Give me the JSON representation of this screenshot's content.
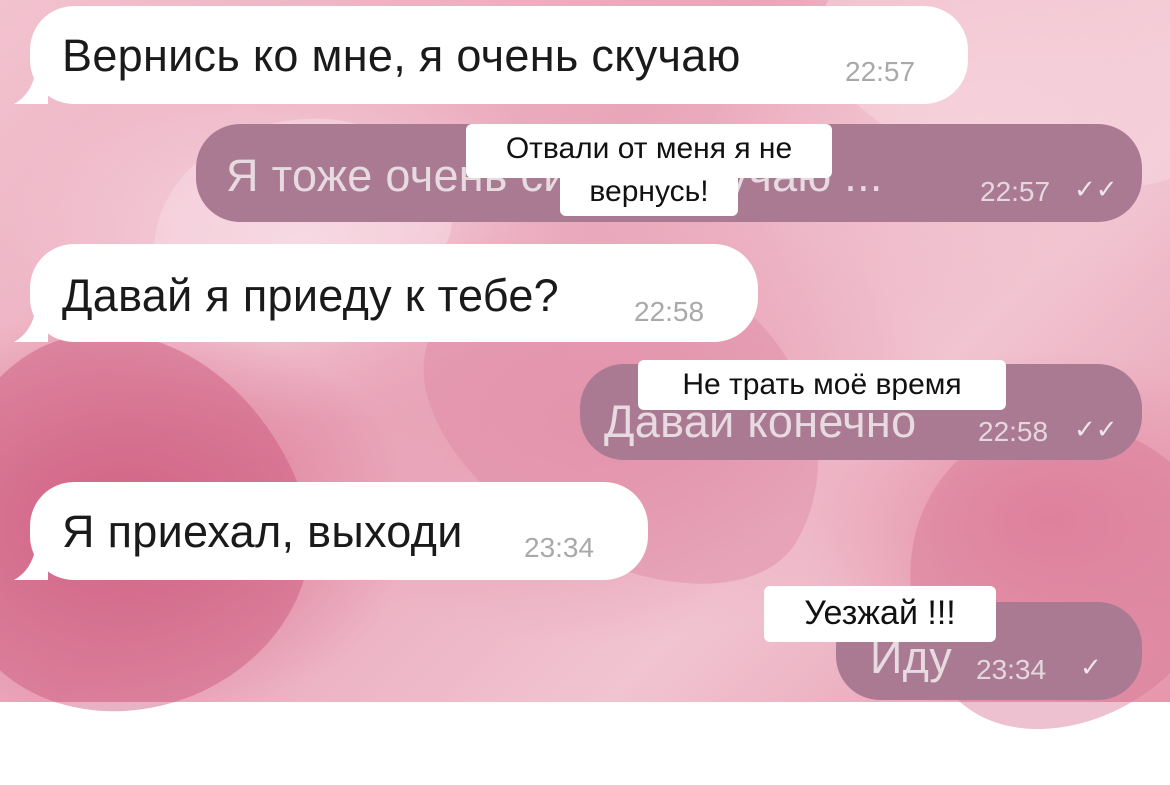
{
  "messages": [
    {
      "side": "incoming",
      "text": "Вернись ко мне, я очень скучаю",
      "time": "22:57"
    },
    {
      "side": "outgoing",
      "text": "Я тоже очень сильно скучаю ...",
      "time": "22:57",
      "status": "read"
    },
    {
      "side": "incoming",
      "text": "Давай я приеду к тебе?",
      "time": "22:58"
    },
    {
      "side": "outgoing",
      "text": "Давай конечно",
      "time": "22:58",
      "status": "read"
    },
    {
      "side": "incoming",
      "text": "Я приехал, выходи",
      "time": "23:34"
    },
    {
      "side": "outgoing",
      "text": "Иду",
      "time": "23:34",
      "status": "sent"
    }
  ],
  "stickers": [
    {
      "line1": "Отвали от меня я не",
      "line2": "вернусь!"
    },
    {
      "text": "Не трать моё время"
    },
    {
      "text": "Уезжай !!!"
    }
  ],
  "icons": {
    "read": "double-check-icon",
    "sent": "single-check-icon"
  },
  "colors": {
    "incoming_bubble": "#ffffff",
    "outgoing_bubble": "#a97a91",
    "sticker_bg": "#ffffff"
  }
}
